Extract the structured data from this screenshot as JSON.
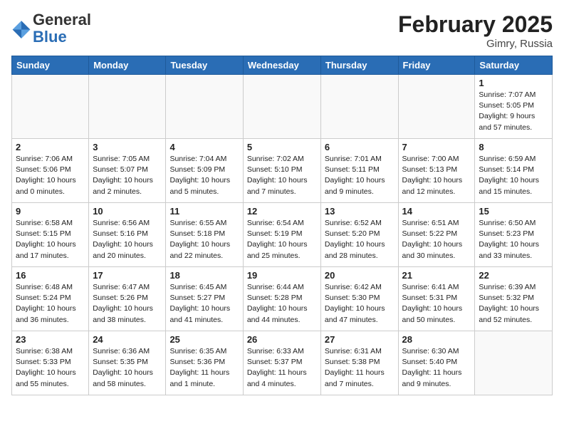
{
  "header": {
    "logo_line1": "General",
    "logo_line2": "Blue",
    "month_title": "February 2025",
    "location": "Gimry, Russia"
  },
  "weekdays": [
    "Sunday",
    "Monday",
    "Tuesday",
    "Wednesday",
    "Thursday",
    "Friday",
    "Saturday"
  ],
  "weeks": [
    [
      {
        "day": "",
        "detail": ""
      },
      {
        "day": "",
        "detail": ""
      },
      {
        "day": "",
        "detail": ""
      },
      {
        "day": "",
        "detail": ""
      },
      {
        "day": "",
        "detail": ""
      },
      {
        "day": "",
        "detail": ""
      },
      {
        "day": "1",
        "detail": "Sunrise: 7:07 AM\nSunset: 5:05 PM\nDaylight: 9 hours and 57 minutes."
      }
    ],
    [
      {
        "day": "2",
        "detail": "Sunrise: 7:06 AM\nSunset: 5:06 PM\nDaylight: 10 hours and 0 minutes."
      },
      {
        "day": "3",
        "detail": "Sunrise: 7:05 AM\nSunset: 5:07 PM\nDaylight: 10 hours and 2 minutes."
      },
      {
        "day": "4",
        "detail": "Sunrise: 7:04 AM\nSunset: 5:09 PM\nDaylight: 10 hours and 5 minutes."
      },
      {
        "day": "5",
        "detail": "Sunrise: 7:02 AM\nSunset: 5:10 PM\nDaylight: 10 hours and 7 minutes."
      },
      {
        "day": "6",
        "detail": "Sunrise: 7:01 AM\nSunset: 5:11 PM\nDaylight: 10 hours and 9 minutes."
      },
      {
        "day": "7",
        "detail": "Sunrise: 7:00 AM\nSunset: 5:13 PM\nDaylight: 10 hours and 12 minutes."
      },
      {
        "day": "8",
        "detail": "Sunrise: 6:59 AM\nSunset: 5:14 PM\nDaylight: 10 hours and 15 minutes."
      }
    ],
    [
      {
        "day": "9",
        "detail": "Sunrise: 6:58 AM\nSunset: 5:15 PM\nDaylight: 10 hours and 17 minutes."
      },
      {
        "day": "10",
        "detail": "Sunrise: 6:56 AM\nSunset: 5:16 PM\nDaylight: 10 hours and 20 minutes."
      },
      {
        "day": "11",
        "detail": "Sunrise: 6:55 AM\nSunset: 5:18 PM\nDaylight: 10 hours and 22 minutes."
      },
      {
        "day": "12",
        "detail": "Sunrise: 6:54 AM\nSunset: 5:19 PM\nDaylight: 10 hours and 25 minutes."
      },
      {
        "day": "13",
        "detail": "Sunrise: 6:52 AM\nSunset: 5:20 PM\nDaylight: 10 hours and 28 minutes."
      },
      {
        "day": "14",
        "detail": "Sunrise: 6:51 AM\nSunset: 5:22 PM\nDaylight: 10 hours and 30 minutes."
      },
      {
        "day": "15",
        "detail": "Sunrise: 6:50 AM\nSunset: 5:23 PM\nDaylight: 10 hours and 33 minutes."
      }
    ],
    [
      {
        "day": "16",
        "detail": "Sunrise: 6:48 AM\nSunset: 5:24 PM\nDaylight: 10 hours and 36 minutes."
      },
      {
        "day": "17",
        "detail": "Sunrise: 6:47 AM\nSunset: 5:26 PM\nDaylight: 10 hours and 38 minutes."
      },
      {
        "day": "18",
        "detail": "Sunrise: 6:45 AM\nSunset: 5:27 PM\nDaylight: 10 hours and 41 minutes."
      },
      {
        "day": "19",
        "detail": "Sunrise: 6:44 AM\nSunset: 5:28 PM\nDaylight: 10 hours and 44 minutes."
      },
      {
        "day": "20",
        "detail": "Sunrise: 6:42 AM\nSunset: 5:30 PM\nDaylight: 10 hours and 47 minutes."
      },
      {
        "day": "21",
        "detail": "Sunrise: 6:41 AM\nSunset: 5:31 PM\nDaylight: 10 hours and 50 minutes."
      },
      {
        "day": "22",
        "detail": "Sunrise: 6:39 AM\nSunset: 5:32 PM\nDaylight: 10 hours and 52 minutes."
      }
    ],
    [
      {
        "day": "23",
        "detail": "Sunrise: 6:38 AM\nSunset: 5:33 PM\nDaylight: 10 hours and 55 minutes."
      },
      {
        "day": "24",
        "detail": "Sunrise: 6:36 AM\nSunset: 5:35 PM\nDaylight: 10 hours and 58 minutes."
      },
      {
        "day": "25",
        "detail": "Sunrise: 6:35 AM\nSunset: 5:36 PM\nDaylight: 11 hours and 1 minute."
      },
      {
        "day": "26",
        "detail": "Sunrise: 6:33 AM\nSunset: 5:37 PM\nDaylight: 11 hours and 4 minutes."
      },
      {
        "day": "27",
        "detail": "Sunrise: 6:31 AM\nSunset: 5:38 PM\nDaylight: 11 hours and 7 minutes."
      },
      {
        "day": "28",
        "detail": "Sunrise: 6:30 AM\nSunset: 5:40 PM\nDaylight: 11 hours and 9 minutes."
      },
      {
        "day": "",
        "detail": ""
      }
    ]
  ]
}
